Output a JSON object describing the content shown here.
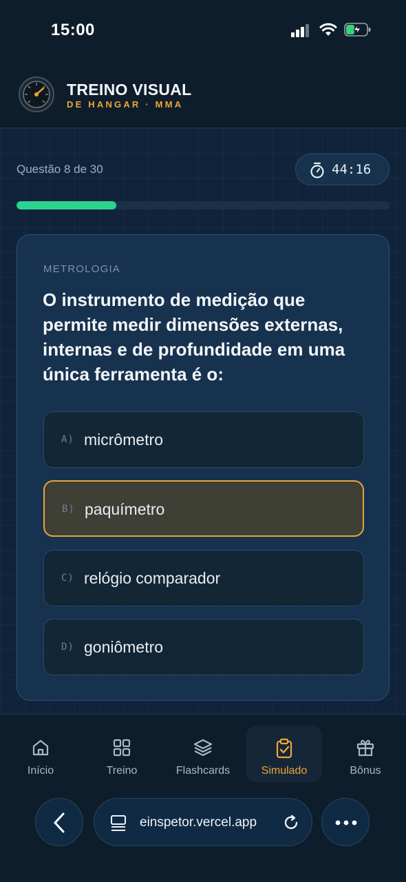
{
  "status_bar": {
    "time": "15:00"
  },
  "header": {
    "title": "TREINO VISUAL",
    "subtitle": "DE HANGAR · MMA"
  },
  "quiz": {
    "counter": "Questão 8 de 30",
    "timer": "44:16",
    "progress_fraction": 0.267,
    "category": "METROLOGIA",
    "question": "O instrumento de medição que permite medir dimensões externas, internas e de profundidade em uma única ferramenta é o:",
    "options": [
      {
        "letter": "A)",
        "text": "micrômetro",
        "selected": false
      },
      {
        "letter": "B)",
        "text": "paquímetro",
        "selected": true
      },
      {
        "letter": "C)",
        "text": "relógio comparador",
        "selected": false
      },
      {
        "letter": "D)",
        "text": "goniômetro",
        "selected": false
      }
    ]
  },
  "nav": {
    "items": [
      {
        "label": "Início",
        "icon": "home-icon",
        "active": false
      },
      {
        "label": "Treino",
        "icon": "grid-icon",
        "active": false
      },
      {
        "label": "Flashcards",
        "icon": "layers-icon",
        "active": false
      },
      {
        "label": "Simulado",
        "icon": "clipboard-check-icon",
        "active": true
      },
      {
        "label": "Bônus",
        "icon": "gift-icon",
        "active": false
      }
    ]
  },
  "browser": {
    "url": "einspetor.vercel.app"
  },
  "colors": {
    "accent": "#f0a632",
    "progress": "#2bd48f",
    "background": "#0e1d2b",
    "card": "#183450"
  }
}
